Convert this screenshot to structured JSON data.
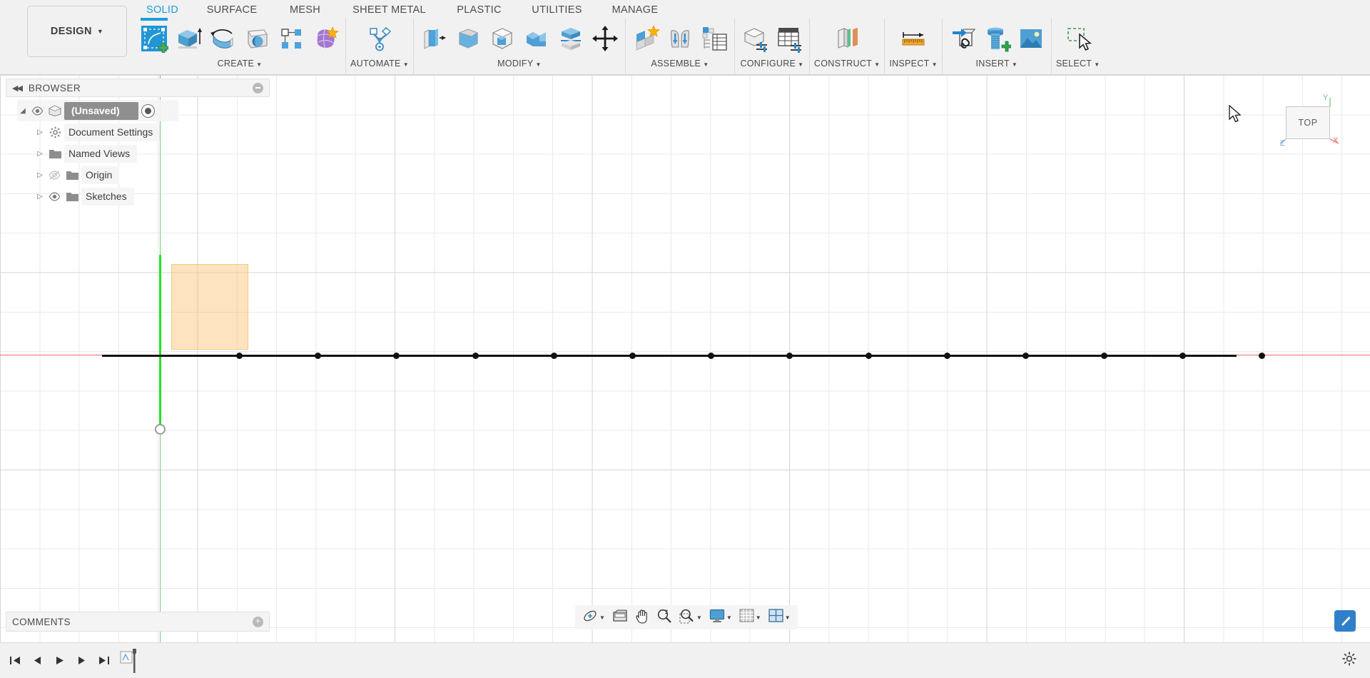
{
  "app": {
    "workspace_label": "DESIGN",
    "workspace_caret": "▼"
  },
  "ribbon": {
    "tabs": [
      {
        "label": "SOLID",
        "active": true
      },
      {
        "label": "SURFACE",
        "active": false
      },
      {
        "label": "MESH",
        "active": false
      },
      {
        "label": "SHEET METAL",
        "active": false
      },
      {
        "label": "PLASTIC",
        "active": false
      },
      {
        "label": "UTILITIES",
        "active": false
      },
      {
        "label": "MANAGE",
        "active": false
      }
    ],
    "panels": [
      {
        "label": "CREATE",
        "caret": "▼"
      },
      {
        "label": "AUTOMATE",
        "caret": "▼"
      },
      {
        "label": "MODIFY",
        "caret": "▼"
      },
      {
        "label": "ASSEMBLE",
        "caret": "▼"
      },
      {
        "label": "CONFIGURE",
        "caret": "▼"
      },
      {
        "label": "CONSTRUCT",
        "caret": "▼"
      },
      {
        "label": "INSPECT",
        "caret": "▼"
      },
      {
        "label": "INSERT",
        "caret": "▼"
      },
      {
        "label": "SELECT",
        "caret": "▼"
      }
    ],
    "tools": {
      "create_sketch": "create-sketch-icon",
      "extrude": "extrude-icon",
      "revolve": "revolve-icon",
      "sweep": "sweep-icon",
      "pattern": "rectangular-pattern-icon",
      "form": "create-form-icon",
      "automate": "automate-icon",
      "press_pull": "press-pull-icon",
      "fillet": "fillet-icon",
      "shell": "shell-icon",
      "combine": "combine-icon",
      "split_body": "split-body-icon",
      "move_copy": "move-copy-icon",
      "new_component": "new-component-icon",
      "joint": "joint-icon",
      "as_built_joint": "configuration-table-icon",
      "configure_design": "configure-design-icon",
      "configure_table": "configuration-grid-icon",
      "offset_plane": "offset-plane-icon",
      "measure": "measure-icon",
      "insert_derive": "insert-derive-icon",
      "insert_mcmaster": "insert-mcmaster-icon",
      "canvas_image": "insert-canvas-image-icon",
      "select": "select-window-icon"
    }
  },
  "browser": {
    "title": "BROWSER",
    "collapse_icon": "collapse-left-icon",
    "panel_button_icon": "minimize-icon",
    "tree": [
      {
        "label": "(Unsaved)",
        "icon": "document-icon",
        "eye": "eye-visible-icon",
        "arrow": "expanded-arrow-icon",
        "root": true,
        "radio": "active-component-radio"
      },
      {
        "label": "Document Settings",
        "icon": "gear-icon",
        "arrow": "collapsed-arrow-icon",
        "root": false
      },
      {
        "label": "Named Views",
        "icon": "folder-icon",
        "arrow": "collapsed-arrow-icon",
        "root": false
      },
      {
        "label": "Origin",
        "icon": "folder-icon",
        "eye": "eye-hidden-icon",
        "arrow": "collapsed-arrow-icon",
        "root": false
      },
      {
        "label": "Sketches",
        "icon": "folder-icon",
        "eye": "eye-visible-icon",
        "arrow": "collapsed-arrow-icon",
        "root": false
      }
    ]
  },
  "comments": {
    "title": "COMMENTS",
    "add_icon": "add-comment-icon"
  },
  "viewcube": {
    "face_label": "TOP",
    "axis_y": "Y",
    "axis_x": "X",
    "axis_z": "Z"
  },
  "navbar": {
    "items": [
      {
        "name": "orbit-icon",
        "caret": "▼"
      },
      {
        "name": "look-at-icon",
        "caret": ""
      },
      {
        "name": "pan-hand-icon",
        "caret": ""
      },
      {
        "name": "zoom-icon",
        "caret": ""
      },
      {
        "name": "zoom-window-icon",
        "caret": "▼"
      },
      {
        "name": "display-settings-icon",
        "caret": "▼"
      },
      {
        "name": "grid-snaps-icon",
        "caret": "▼"
      },
      {
        "name": "viewports-icon",
        "caret": "▼"
      }
    ]
  },
  "timeline": {
    "buttons": [
      {
        "name": "go-to-beginning-icon"
      },
      {
        "name": "step-back-icon"
      },
      {
        "name": "play-icon"
      },
      {
        "name": "step-forward-icon"
      },
      {
        "name": "go-to-end-icon"
      },
      {
        "name": "timeline-marker-icon"
      }
    ],
    "settings_icon": "timeline-settings-icon"
  },
  "canvas": {
    "sketch_name": "sketch-profile",
    "origin_point": "sketch-origin-point",
    "construction_line": "sketch-line",
    "point_count": 14,
    "highlight_icon": "help-highlight-icon"
  },
  "colors": {
    "accent": "#1b9ddb",
    "x_axis": "#ef6a6a",
    "y_axis": "#25e325",
    "sketch_fill": "#fadfb0",
    "ribbon_bg": "#f1f1f1"
  }
}
